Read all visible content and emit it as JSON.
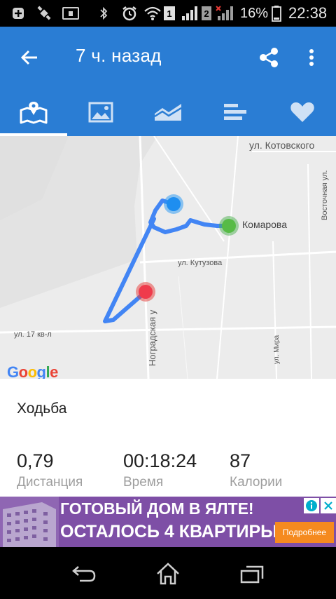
{
  "status_bar": {
    "battery_percent": "16%",
    "time": "22:38",
    "sim1": "1",
    "sim2": "2",
    "icons": [
      "plus-icon",
      "satellite-icon",
      "notification-icon",
      "bluetooth-icon",
      "alarm-icon",
      "wifi-icon",
      "signal-icon",
      "battery-icon"
    ]
  },
  "app_bar": {
    "title": "7 ч. назад",
    "back_icon": "arrow-left-icon",
    "share_icon": "share-icon",
    "menu_icon": "more-vert-icon"
  },
  "tabs": [
    {
      "icon": "map-icon",
      "selected": true
    },
    {
      "icon": "image-icon",
      "selected": false
    },
    {
      "icon": "area-chart-icon",
      "selected": false
    },
    {
      "icon": "bar-list-icon",
      "selected": false
    },
    {
      "icon": "heart-icon",
      "selected": false
    }
  ],
  "map": {
    "labels": {
      "kotovskogo": "ул. Котовского",
      "vostochnaya": "Восточная ул.",
      "komarova": "Комарова",
      "kutuzova": "ул. Кутузова",
      "nogradskaya": "Ноградская у",
      "kvartal17": "ул. 17 кв-л",
      "mira": "ул. Мира"
    },
    "logo": "Google",
    "colors": {
      "route": "#4285f4",
      "start": "#4caf50",
      "end": "#e53935",
      "current": "#2196f3"
    }
  },
  "activity": {
    "type": "Ходьба",
    "stats": [
      {
        "value": "0,79",
        "label": "Дистанция"
      },
      {
        "value": "00:18:24",
        "label": "Время"
      },
      {
        "value": "87",
        "label": "Калории"
      }
    ]
  },
  "ad": {
    "line1": "ГОТОВЫЙ ДОМ В ЯЛТЕ!",
    "line2": "ОСТАЛОСЬ 4 КВАРТИРЫ",
    "cta": "Подробнее",
    "bg_color": "#7e4fa6",
    "cta_color": "#f58a1f"
  },
  "nav_bar": {
    "icons": [
      "back-nav-icon",
      "home-nav-icon",
      "recents-nav-icon"
    ]
  }
}
